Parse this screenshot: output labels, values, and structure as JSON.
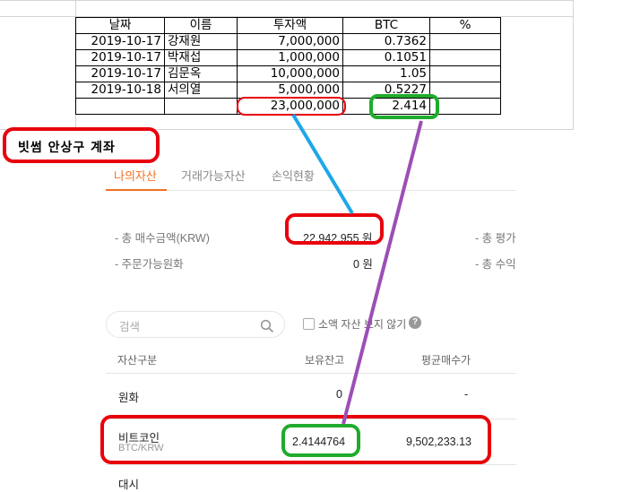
{
  "spreadsheet": {
    "headers": [
      "날짜",
      "이름",
      "투자액",
      "BTC",
      "%"
    ],
    "rows": [
      [
        "2019-10-17",
        "강재원",
        "7,000,000",
        "0.7362",
        ""
      ],
      [
        "2019-10-17",
        "박재섭",
        "1,000,000",
        "0.1051",
        ""
      ],
      [
        "2019-10-17",
        "김문옥",
        "10,000,000",
        "1.05",
        ""
      ],
      [
        "2019-10-18",
        "서의열",
        "5,000,000",
        "0.5227",
        ""
      ]
    ],
    "total_amount": "23,000,000",
    "total_btc": "2.414"
  },
  "annotation": {
    "title": "빗썸 안상구 계좌"
  },
  "tabs": [
    {
      "label": "나의자산",
      "active": true
    },
    {
      "label": "거래가능자산",
      "active": false
    },
    {
      "label": "손익현황",
      "active": false
    }
  ],
  "summary": {
    "total_buy_label": "- 총 매수금액(KRW)",
    "total_buy_value": "22,942,955 원",
    "order_krw_label": "- 주문가능원화",
    "order_krw_value": "0 원",
    "total_eval_label": "- 총 평가",
    "total_profit_label": "- 총 수익"
  },
  "search": {
    "placeholder": "검색",
    "hide_small_label": "소액 자산 보지 않기"
  },
  "columns": {
    "asset": "자산구분",
    "holding": "보유잔고",
    "avg_price": "평균매수가"
  },
  "assets": [
    {
      "name": "원화",
      "sub": "",
      "holding": "0",
      "avg": "-"
    },
    {
      "name": "비트코인",
      "sub": "BTC/KRW",
      "holding": "2.4144764",
      "avg": "9,502,233.13"
    },
    {
      "name": "대시",
      "sub": "",
      "holding": "",
      "avg": ""
    }
  ],
  "colors": {
    "accent": "#f37021",
    "annotation_red": "#e8000b",
    "annotation_green": "#1fab2d",
    "arrow_blue": "#1ea7e8",
    "arrow_purple": "#9b4fb5"
  }
}
